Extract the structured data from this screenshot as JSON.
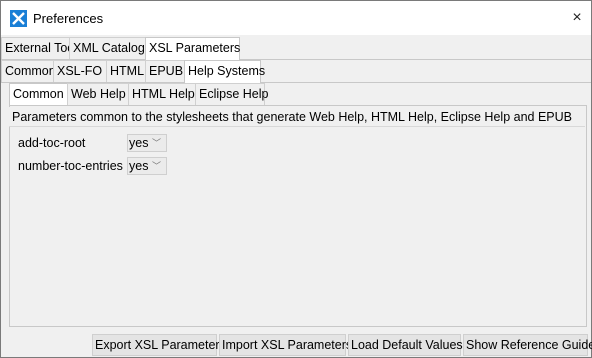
{
  "window": {
    "title": "Preferences"
  },
  "tabs_level1": [
    {
      "label": "External Tools",
      "active": false
    },
    {
      "label": "XML Catalog",
      "active": false
    },
    {
      "label": "XSL Parameters",
      "active": true
    }
  ],
  "tabs_level2": [
    {
      "label": "Common",
      "active": false
    },
    {
      "label": "XSL-FO",
      "active": false
    },
    {
      "label": "HTML",
      "active": false
    },
    {
      "label": "EPUB",
      "active": false
    },
    {
      "label": "Help Systems",
      "active": true
    }
  ],
  "tabs_level3": [
    {
      "label": "Common",
      "active": true
    },
    {
      "label": "Web Help",
      "active": false
    },
    {
      "label": "HTML Help",
      "active": false
    },
    {
      "label": "Eclipse Help",
      "active": false
    }
  ],
  "description": "Parameters common to the stylesheets that generate Web Help, HTML Help, Eclipse Help and EPUB",
  "parameters": [
    {
      "name": "add-toc-root",
      "value": "yes"
    },
    {
      "name": "number-toc-entries",
      "value": "yes"
    }
  ],
  "buttons": {
    "export": "Export XSL Parameters",
    "import": "Import XSL Parameters",
    "load_defaults": "Load Default Values",
    "reference": "Show Reference Guide"
  },
  "icons": {
    "close": "×",
    "chevron": "﹀"
  }
}
